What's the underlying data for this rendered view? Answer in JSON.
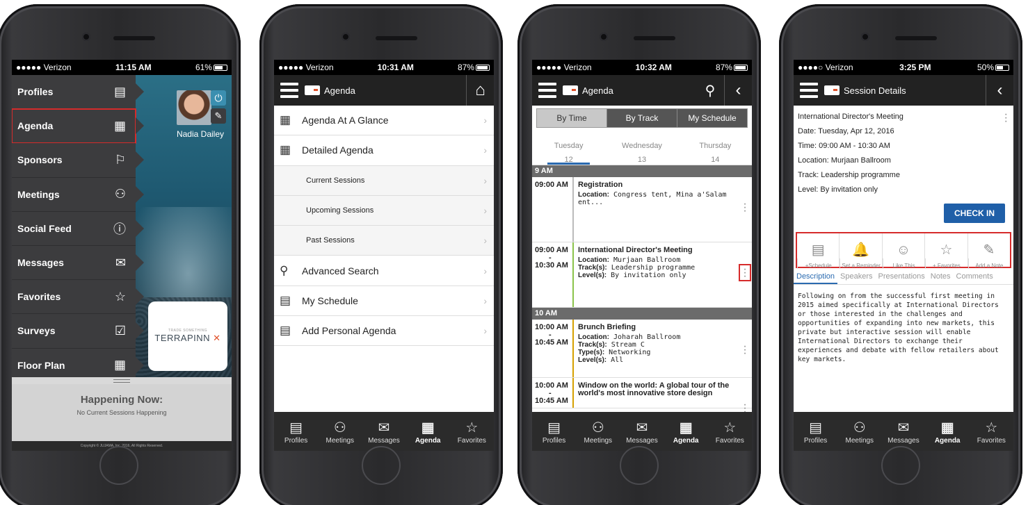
{
  "phone1": {
    "status": {
      "carrier": "●●●●● Verizon",
      "time": "11:15 AM",
      "battery": "61%"
    },
    "menu": [
      {
        "label": "Profiles",
        "icon": "profile-icon",
        "glyph": "▤"
      },
      {
        "label": "Agenda",
        "icon": "calendar-icon",
        "glyph": "▦"
      },
      {
        "label": "Sponsors",
        "icon": "flag-icon",
        "glyph": "⚐"
      },
      {
        "label": "Meetings",
        "icon": "people-icon",
        "glyph": "⚇"
      },
      {
        "label": "Social Feed",
        "icon": "alert-icon",
        "glyph": "ⓘ"
      },
      {
        "label": "Messages",
        "icon": "envelope-icon",
        "glyph": "✉"
      },
      {
        "label": "Favorites",
        "icon": "star-icon",
        "glyph": "☆"
      },
      {
        "label": "Surveys",
        "icon": "survey-icon",
        "glyph": "☑"
      },
      {
        "label": "Floor Plan",
        "icon": "floorplan-icon",
        "glyph": "▦"
      }
    ],
    "user_name": "Nadia Dailey",
    "logo_tag": "TRADE SOMETHING",
    "logo_word": "TERRAPINN",
    "happening_title": "Happening Now:",
    "happening_sub": "No Current Sessions Happening",
    "copyright": "Copyright © JUJAMA, Inc. 2016, All Rights Reserved."
  },
  "phone2": {
    "status": {
      "carrier": "●●●●● Verizon",
      "time": "10:31 AM",
      "battery": "87%"
    },
    "title": "Agenda",
    "items": [
      {
        "label": "Agenda At A Glance",
        "glyph": "▦"
      },
      {
        "label": "Detailed Agenda",
        "glyph": "▦"
      },
      {
        "label": "Current Sessions",
        "glyph": ""
      },
      {
        "label": "Upcoming Sessions",
        "glyph": ""
      },
      {
        "label": "Past Sessions",
        "glyph": ""
      },
      {
        "label": "Advanced Search",
        "glyph": "⚲"
      },
      {
        "label": "My Schedule",
        "glyph": "▤"
      },
      {
        "label": "Add Personal Agenda",
        "glyph": "▤"
      }
    ]
  },
  "phone3": {
    "status": {
      "carrier": "●●●●● Verizon",
      "time": "10:32 AM",
      "battery": "87%"
    },
    "title": "Agenda",
    "segments": [
      "By Time",
      "By Track",
      "My Schedule"
    ],
    "days": [
      {
        "name": "Tuesday",
        "num": "12"
      },
      {
        "name": "Wednesday",
        "num": "13"
      },
      {
        "name": "Thursday",
        "num": "14"
      }
    ],
    "hour1": "9 AM",
    "hour2": "10 AM",
    "sessions": [
      {
        "start": "09:00 AM",
        "end": "",
        "title": "Registration",
        "l1k": "Location:",
        "l1v": " Congress tent, Mina a'Salam ent...",
        "l2k": "",
        "l2v": "",
        "l3k": "",
        "l3v": "",
        "l4k": "",
        "l4v": "",
        "color": "#bbbbbb"
      },
      {
        "start": "09:00 AM",
        "end": "10:30 AM",
        "title": "International Director's Meeting",
        "l1k": "Location:",
        "l1v": " Murjaan Ballroom",
        "l2k": "Track(s):",
        "l2v": " Leadership programme",
        "l3k": "Level(s):",
        "l3v": " By invitation only",
        "l4k": "",
        "l4v": "",
        "color": "#8bc34a"
      },
      {
        "start": "10:00 AM",
        "end": "10:45 AM",
        "title": "Brunch Briefing",
        "l1k": "Location:",
        "l1v": " Joharah Ballroom",
        "l2k": "Track(s):",
        "l2v": " Stream C",
        "l3k": "Type(s):",
        "l3v": " Networking",
        "l4k": "Level(s):",
        "l4v": " All",
        "color": "#d5a000"
      },
      {
        "start": "10:00 AM",
        "end": "10:45 AM",
        "title": "Window on the world: A global tour of the world's most innovative store design",
        "l1k": "",
        "l1v": "",
        "l2k": "",
        "l2v": "",
        "l3k": "",
        "l3v": "",
        "l4k": "",
        "l4v": "",
        "color": "#d5a000"
      }
    ]
  },
  "phone4": {
    "status": {
      "carrier": "●●●●○ Verizon",
      "time": "3:25 PM",
      "battery": "50%"
    },
    "title": "Session Details",
    "session_title": "International Director's Meeting",
    "date": "Date: Tuesday, Apr 12, 2016",
    "time": "Time: 09:00 AM - 10:30 AM",
    "location": "Location: Murjaan Ballroom",
    "track": "Track:  Leadership programme",
    "level": "Level:  By invitation only",
    "checkin": "CHECK IN",
    "actions": [
      {
        "label": "+Schedule",
        "glyph": "▤"
      },
      {
        "label": "Set a Reminder",
        "glyph": "🔔"
      },
      {
        "label": "Like This",
        "glyph": "☺"
      },
      {
        "label": "+ Favorites",
        "glyph": "☆"
      },
      {
        "label": "Add a Note",
        "glyph": "✎"
      }
    ],
    "tabs": [
      "Description",
      "Speakers",
      "Presentations",
      "Notes",
      "Comments"
    ],
    "description": "Following on from the successful first meeting in 2015 aimed specifically at International Directors or those interested in the challenges and opportunities of expanding into new markets, this private but interactive session will enable International Directors to exchange their experiences and debate with fellow retailers about key markets."
  },
  "tabbar": [
    {
      "label": "Profiles",
      "glyph": "▤"
    },
    {
      "label": "Meetings",
      "glyph": "⚇"
    },
    {
      "label": "Messages",
      "glyph": "✉"
    },
    {
      "label": "Agenda",
      "glyph": "▦"
    },
    {
      "label": "Favorites",
      "glyph": "☆"
    }
  ],
  "colors": {
    "accent": "#2a6ab0",
    "highlight": "#d62b2b",
    "checkin": "#1f5fa8",
    "brand": "#e0512a"
  }
}
